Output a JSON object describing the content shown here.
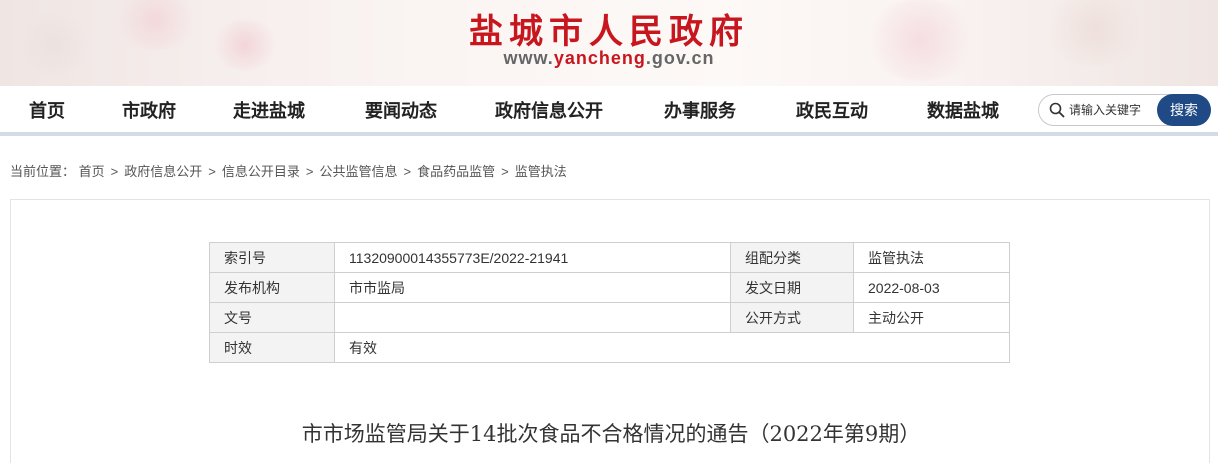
{
  "header": {
    "site_title": "盐城市人民政府",
    "domain_prefix": "www.",
    "domain_accent": "yancheng",
    "domain_suffix": ".gov.cn"
  },
  "nav": {
    "items": [
      "首页",
      "市政府",
      "走进盐城",
      "要闻动态",
      "政府信息公开",
      "办事服务",
      "政民互动",
      "数据盐城"
    ]
  },
  "search": {
    "placeholder": "请输入关键字",
    "button_label": "搜索"
  },
  "breadcrumb": {
    "label": "当前位置：",
    "items": [
      "首页",
      "政府信息公开",
      "信息公开目录",
      "公共监管信息",
      "食品药品监管",
      "监管执法"
    ],
    "separator": ">"
  },
  "info_table": {
    "rows": [
      {
        "label1": "索引号",
        "value1": "11320900014355773E/2022-21941",
        "label2": "组配分类",
        "value2": "监管执法"
      },
      {
        "label1": "发布机构",
        "value1": "市市监局",
        "label2": "发文日期",
        "value2": "2022-08-03"
      },
      {
        "label1": "文号",
        "value1": "",
        "label2": "公开方式",
        "value2": "主动公开"
      },
      {
        "label1": "时效",
        "value1": "有效"
      }
    ]
  },
  "document": {
    "title": "市市场监管局关于14批次食品不合格情况的通告（2022年第9期）"
  },
  "colors": {
    "title_red": "#c8161e",
    "search_button": "#1f4a86",
    "nav_underline": "#d3dbe6"
  }
}
